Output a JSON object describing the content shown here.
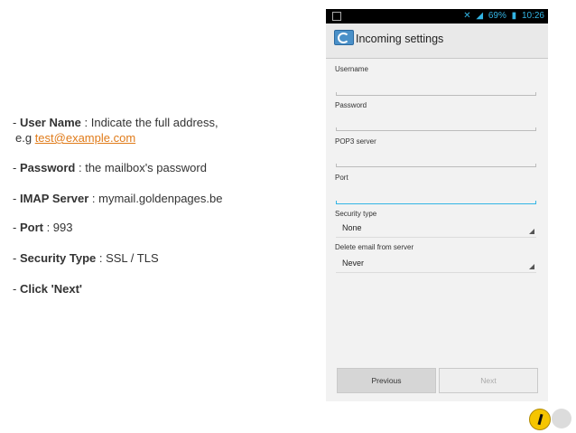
{
  "instructions": {
    "user_name_label": "User Name",
    "user_name_text": " : Indicate the full address,",
    "example_prefix": "e.g ",
    "example_link": "test@example.com",
    "password_label": "Password",
    "password_text": " : the mailbox's password",
    "imap_label": "IMAP Server",
    "imap_text": " : mymail.goldenpages.be",
    "port_label": "Port",
    "port_text": " : 993",
    "security_label": "Security Type",
    "security_text": " : SSL / TLS",
    "click_label": "Click 'Next'",
    "dash": "- "
  },
  "phone": {
    "status": {
      "battery": "69%",
      "time": "10:26"
    },
    "title": "Incoming settings",
    "fields": {
      "username_label": "Username",
      "password_label": "Password",
      "pop3_label": "POP3 server",
      "port_label": "Port",
      "security_label": "Security type",
      "security_value": "None",
      "delete_label": "Delete email from server",
      "delete_value": "Never"
    },
    "buttons": {
      "previous": "Previous",
      "next": "Next"
    }
  },
  "colors": {
    "link": "#e07b1a",
    "accent": "#33b5e5",
    "logo": "#f6c500"
  }
}
